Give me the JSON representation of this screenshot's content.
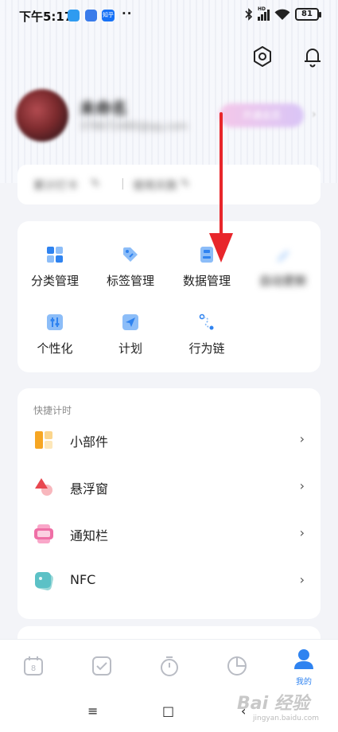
{
  "status_bar": {
    "time": "下午5:17",
    "app_badge_zhihu": "知乎",
    "dots": "··",
    "signal": "HD",
    "battery": "81"
  },
  "profile": {
    "name": "未命名",
    "email": "378672480@qq.com",
    "vip_label": "开通会员"
  },
  "stats": {
    "left_label": "累计打卡",
    "right_label": "使用天数"
  },
  "features": [
    {
      "label": "分类管理",
      "icon": "category-icon",
      "color": "#2f83f0"
    },
    {
      "label": "标签管理",
      "icon": "tag-icon",
      "color": "#2f83f0"
    },
    {
      "label": "数据管理",
      "icon": "data-icon",
      "color": "#2f83f0"
    },
    {
      "label": "自动更新",
      "icon": "pen-icon",
      "color": "#2f83f0"
    },
    {
      "label": "个性化",
      "icon": "sliders-icon",
      "color": "#2f83f0"
    },
    {
      "label": "计划",
      "icon": "send-icon",
      "color": "#2f83f0"
    },
    {
      "label": "行为链",
      "icon": "chain-icon",
      "color": "#2f83f0"
    }
  ],
  "quick_timer": {
    "title": "快捷计时",
    "items": [
      {
        "label": "小部件",
        "icon": "widget-icon"
      },
      {
        "label": "悬浮窗",
        "icon": "float-window-icon"
      },
      {
        "label": "通知栏",
        "icon": "notification-bar-icon"
      },
      {
        "label": "NFC",
        "icon": "nfc-icon"
      }
    ],
    "chevron": "›"
  },
  "tabbar": {
    "active_label": "我的",
    "tabs": [
      "calendar-icon",
      "check-icon",
      "timer-icon",
      "stats-icon",
      "profile-icon"
    ]
  },
  "navbar": {
    "menu": "≡",
    "home": "□",
    "back": "‹"
  },
  "watermark": {
    "text": "Bai 经验",
    "sub": "jingyan.baidu.com"
  },
  "colors": {
    "accent": "#2f83f0",
    "arrow": "#e8262b"
  }
}
